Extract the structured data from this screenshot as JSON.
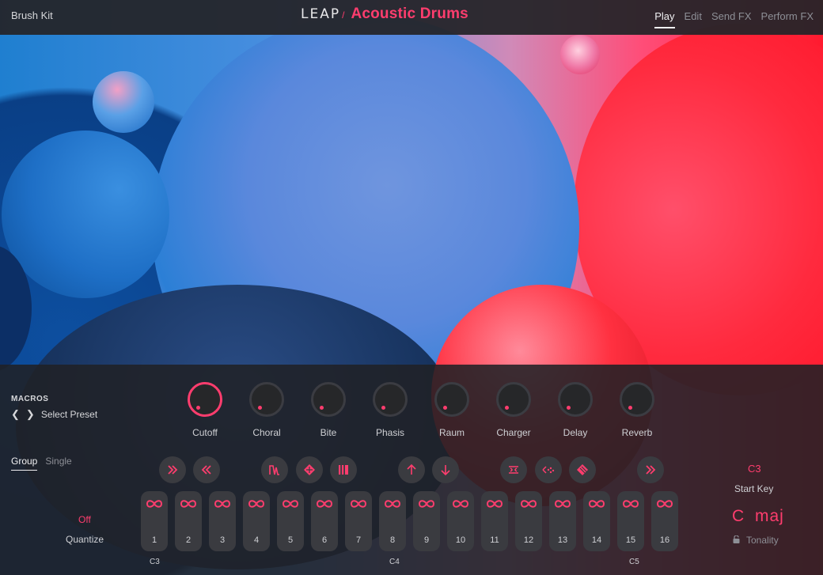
{
  "header": {
    "preset_name": "Brush Kit",
    "logo": {
      "brand": "LEAP",
      "slash": "/",
      "product": "Acoustic Drums"
    },
    "tabs": [
      {
        "label": "Play",
        "active": true
      },
      {
        "label": "Edit",
        "active": false
      },
      {
        "label": "Send FX",
        "active": false
      },
      {
        "label": "Perform FX",
        "active": false
      }
    ]
  },
  "macros": {
    "title": "MACROS",
    "preset_label": "Select Preset",
    "knobs": [
      {
        "label": "Cutoff",
        "highlighted": true
      },
      {
        "label": "Choral",
        "highlighted": false
      },
      {
        "label": "Bite",
        "highlighted": false
      },
      {
        "label": "Phasis",
        "highlighted": false
      },
      {
        "label": "Raum",
        "highlighted": false
      },
      {
        "label": "Charger",
        "highlighted": false
      },
      {
        "label": "Delay",
        "highlighted": false
      },
      {
        "label": "Reverb",
        "highlighted": false
      }
    ]
  },
  "group_tabs": [
    {
      "label": "Group",
      "active": true
    },
    {
      "label": "Single",
      "active": false
    }
  ],
  "quantize": {
    "value": "Off",
    "label": "Quantize"
  },
  "action_buttons": [
    {
      "icon": "fast-forward-icon"
    },
    {
      "icon": "rewind-icon"
    },
    {
      "icon": "envelope-icon"
    },
    {
      "icon": "scatter-icon"
    },
    {
      "icon": "stutter-icon"
    },
    {
      "icon": "arrow-up-icon"
    },
    {
      "icon": "arrow-down-icon"
    },
    {
      "icon": "reverse-icon"
    },
    {
      "icon": "scatter-left-icon"
    },
    {
      "icon": "scatter-alt-icon"
    },
    {
      "icon": "fast-forward-icon"
    }
  ],
  "pads": [
    "1",
    "2",
    "3",
    "4",
    "5",
    "6",
    "7",
    "8",
    "9",
    "10",
    "11",
    "12",
    "13",
    "14",
    "15",
    "16"
  ],
  "keyboard_labels": [
    "C3",
    "C4",
    "C5"
  ],
  "start_key": {
    "value": "C3",
    "label": "Start Key"
  },
  "tonality": {
    "value": "C  maj",
    "label": "Tonality"
  },
  "colors": {
    "accent": "#ff3d6e",
    "panel": "#202125",
    "pad": "#3a3b40"
  }
}
